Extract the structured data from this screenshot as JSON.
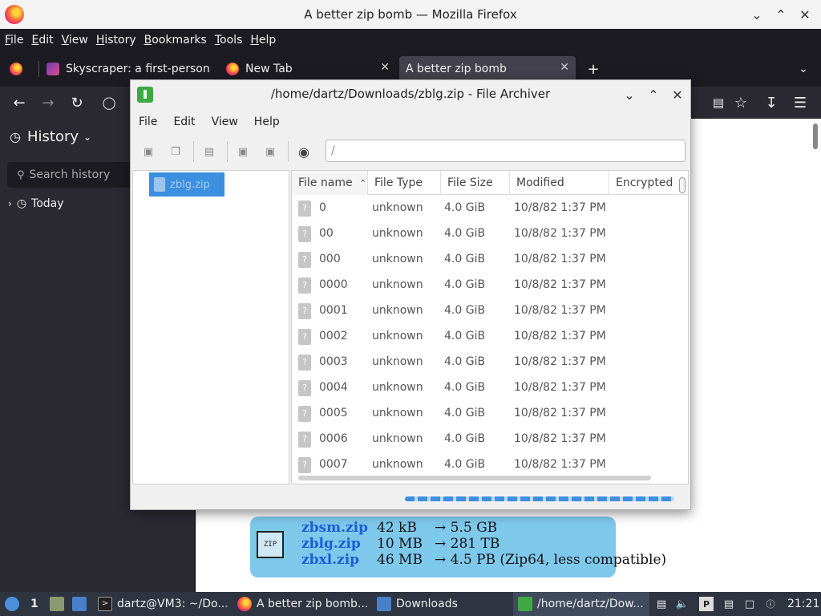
{
  "firefox": {
    "window_title": "A better zip bomb — Mozilla Firefox",
    "menu": [
      "File",
      "Edit",
      "View",
      "History",
      "Bookmarks",
      "Tools",
      "Help"
    ],
    "tabs": [
      {
        "label": "Skyscraper: a first-person",
        "active": false
      },
      {
        "label": "New Tab",
        "active": false
      },
      {
        "label": "A better zip bomb",
        "active": true
      }
    ],
    "sidebar": {
      "title": "History",
      "search_placeholder": "Search history",
      "group": "Today"
    },
    "page": {
      "rows": [
        {
          "name": "zbsm.zip",
          "size": "42 kB",
          "expanded": "→ 5.5 GB"
        },
        {
          "name": "zblg.zip",
          "size": "10 MB",
          "expanded": "→ 281 TB"
        },
        {
          "name": "zbxl.zip",
          "size": "46 MB",
          "expanded": "→ 4.5 PB (Zip64, less compatible)"
        }
      ]
    }
  },
  "archiver": {
    "title": "/home/dartz/Downloads/zblg.zip - File Archiver",
    "menu": [
      "File",
      "Edit",
      "View",
      "Help"
    ],
    "location": "/",
    "tree_item": "zblg.zip",
    "columns": [
      "File name",
      "File Type",
      "File Size",
      "Modified",
      "Encrypted"
    ],
    "files": [
      {
        "name": "0",
        "type": "unknown",
        "size": "4.0 GiB",
        "modified": "10/8/82 1:37 PM"
      },
      {
        "name": "00",
        "type": "unknown",
        "size": "4.0 GiB",
        "modified": "10/8/82 1:37 PM"
      },
      {
        "name": "000",
        "type": "unknown",
        "size": "4.0 GiB",
        "modified": "10/8/82 1:37 PM"
      },
      {
        "name": "0000",
        "type": "unknown",
        "size": "4.0 GiB",
        "modified": "10/8/82 1:37 PM"
      },
      {
        "name": "0001",
        "type": "unknown",
        "size": "4.0 GiB",
        "modified": "10/8/82 1:37 PM"
      },
      {
        "name": "0002",
        "type": "unknown",
        "size": "4.0 GiB",
        "modified": "10/8/82 1:37 PM"
      },
      {
        "name": "0003",
        "type": "unknown",
        "size": "4.0 GiB",
        "modified": "10/8/82 1:37 PM"
      },
      {
        "name": "0004",
        "type": "unknown",
        "size": "4.0 GiB",
        "modified": "10/8/82 1:37 PM"
      },
      {
        "name": "0005",
        "type": "unknown",
        "size": "4.0 GiB",
        "modified": "10/8/82 1:37 PM"
      },
      {
        "name": "0006",
        "type": "unknown",
        "size": "4.0 GiB",
        "modified": "10/8/82 1:37 PM"
      },
      {
        "name": "0007",
        "type": "unknown",
        "size": "4.0 GiB",
        "modified": "10/8/82 1:37 PM"
      }
    ]
  },
  "taskbar": {
    "workspace": "1",
    "tasks": [
      {
        "label": "dartz@VM3: ~/Do..."
      },
      {
        "label": "A better zip bomb..."
      },
      {
        "label": "Downloads"
      },
      {
        "label": "/home/dartz/Dow..."
      }
    ],
    "clock": "21:21"
  },
  "colors": {
    "accent": "#3d8fe0",
    "firefox_dark": "#1c1b22",
    "taskbar": "#2e3440",
    "link": "#1a5fd6"
  }
}
